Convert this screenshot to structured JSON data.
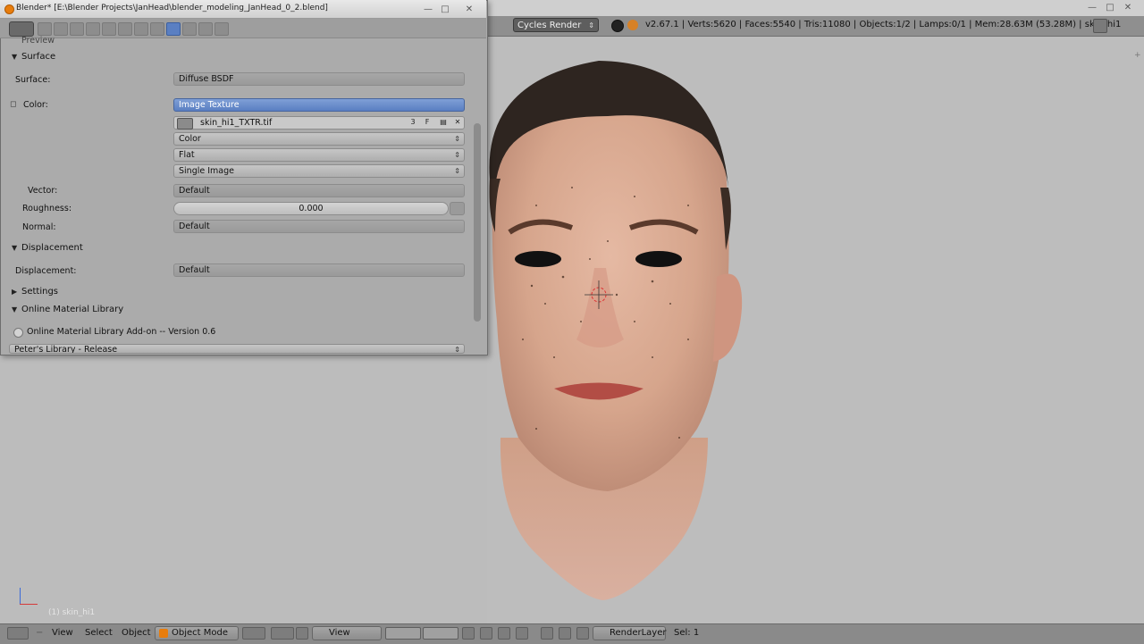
{
  "window": {
    "title": "Blender* [E:\\Blender Projects\\JanHead\\blender_modeling_JanHead_0_2.blend]"
  },
  "info_header": {
    "render_engine": "Cycles Render",
    "stats": "v2.67.1 | Verts:5620 | Faces:5540 | Tris:11080 | Objects:1/2 | Lamps:0/1 | Mem:28.63M (53.28M) | skin_hi1"
  },
  "properties": {
    "partial_top": "Preview",
    "surface_section": "Surface",
    "surface_label": "Surface:",
    "surface_value": "Diffuse BSDF",
    "color_label": "Color:",
    "color_value": "Image Texture",
    "image_name": "skin_hi1_TXTR.tif",
    "image_users": "3",
    "image_fake": "F",
    "color_space": "Color",
    "projection": "Flat",
    "source": "Single Image",
    "vector_label": "Vector:",
    "vector_value": "Default",
    "roughness_label": "Roughness:",
    "roughness_value": "0.000",
    "normal_label": "Normal:",
    "normal_value": "Default",
    "displacement_section": "Displacement",
    "displacement_label": "Displacement:",
    "displacement_value": "Default",
    "settings_section": "Settings",
    "oml_section": "Online Material Library",
    "oml_addon": "Online Material Library Add-on -- Version 0.6",
    "partial_bottom": "Peter's Library - Release"
  },
  "viewport": {
    "object_label": "(1) skin_hi1"
  },
  "bottom_bar": {
    "view": "View",
    "select": "Select",
    "object": "Object",
    "mode": "Object Mode",
    "view2": "View",
    "render_layer": "RenderLayer",
    "sel": "Sel: 1"
  },
  "colors": {
    "accent": "#5a7fc2",
    "panel": "#ababab",
    "viewport": "#bdbdbd"
  },
  "icons": [
    "blender-logo-icon",
    "window-minimize-icon",
    "window-maximize-icon",
    "window-close-icon",
    "editor-type-icon",
    "material-icon",
    "browse-image-icon",
    "open-file-icon",
    "unlink-icon",
    "triangle-down-icon",
    "triangle-right-icon",
    "mode-icon",
    "viewport-shading-icon",
    "pivot-icon",
    "manipulator-icon",
    "layer-icon",
    "render-layer-icon"
  ]
}
